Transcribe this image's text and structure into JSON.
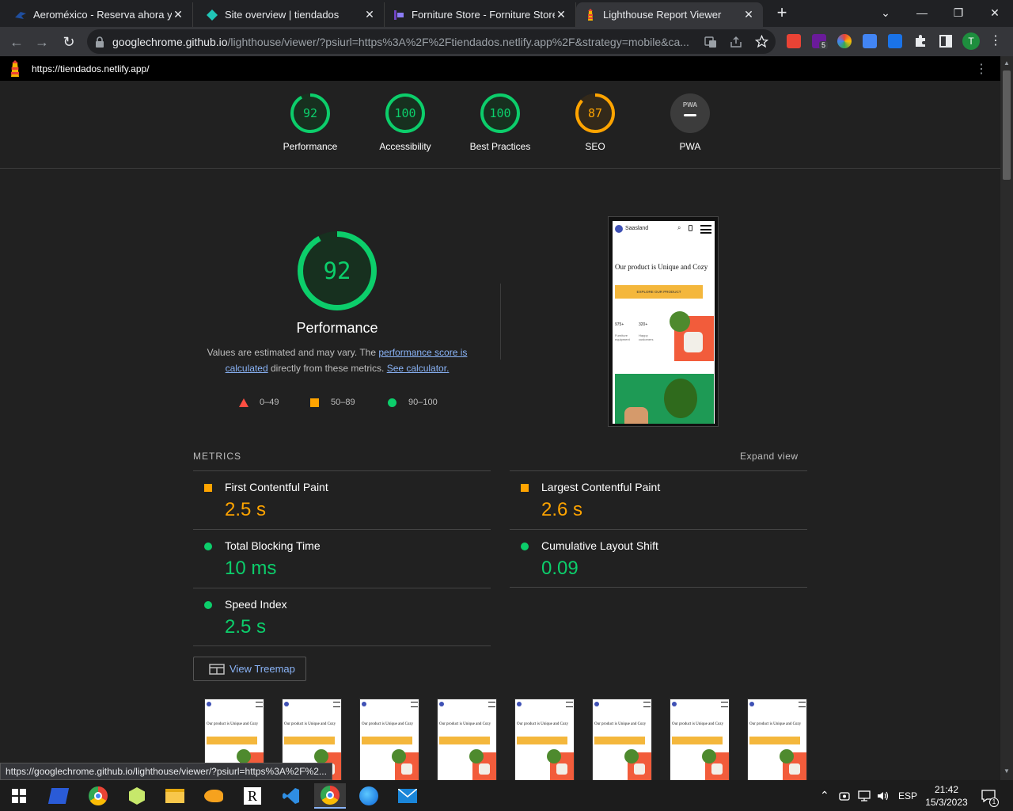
{
  "browser": {
    "tabs": [
      {
        "title": "Aeroméxico - Reserva ahora y vu",
        "close": "✕"
      },
      {
        "title": "Site overview | tiendados",
        "close": "✕"
      },
      {
        "title": "Forniture Store - Forniture Store",
        "close": "✕"
      },
      {
        "title": "Lighthouse Report Viewer",
        "close": "✕"
      }
    ],
    "new_tab": "+",
    "url_host": "googlechrome.github.io",
    "url_path": "/lighthouse/viewer/?psiurl=https%3A%2F%2Ftiendados.netlify.app%2F&strategy=mobile&ca...",
    "ext_badge": "5",
    "profile_initial": "T"
  },
  "report": {
    "topbar_url": "https://tiendados.netlify.app/",
    "scores": [
      {
        "value": "92",
        "label": "Performance",
        "color": "#0cce6b",
        "fraction": 0.92
      },
      {
        "value": "100",
        "label": "Accessibility",
        "color": "#0cce6b",
        "fraction": 1.0
      },
      {
        "value": "100",
        "label": "Best Practices",
        "color": "#0cce6b",
        "fraction": 1.0
      },
      {
        "value": "87",
        "label": "SEO",
        "color": "#ffa400",
        "fraction": 0.87
      },
      {
        "value": "",
        "label": "PWA",
        "color": "#9e9e9e",
        "fraction": 0
      }
    ],
    "pwa_badge": "PWA",
    "perf": {
      "score": "92",
      "fraction": 0.92,
      "title": "Performance",
      "desc_1": "Values are estimated and may vary. The ",
      "link_1": "performance score is calculated",
      "desc_2": " directly from these metrics. ",
      "link_2": "See calculator."
    },
    "legend": [
      {
        "range": "0–49",
        "shape": "triangle",
        "color": "#ff4e42"
      },
      {
        "range": "50–89",
        "shape": "square",
        "color": "#ffa400"
      },
      {
        "range": "90–100",
        "shape": "circle",
        "color": "#0cce6b"
      }
    ],
    "screenshot": {
      "brand": "Saasland",
      "headline": "Our product is Unique and Cozy",
      "cta": "EXPLORE OUR PRODUCT",
      "stat1": "975+",
      "stat1_label": "Furniture equipment",
      "stat2": "320+",
      "stat2_label": "Happy customers"
    },
    "metrics_heading": "METRICS",
    "expand_view": "Expand view",
    "metrics": [
      {
        "name": "First Contentful Paint",
        "value": "2.5 s",
        "rating": "average",
        "color": "#ffa400"
      },
      {
        "name": "Largest Contentful Paint",
        "value": "2.6 s",
        "rating": "average",
        "color": "#ffa400"
      },
      {
        "name": "Total Blocking Time",
        "value": "10 ms",
        "rating": "pass",
        "color": "#0cce6b"
      },
      {
        "name": "Cumulative Layout Shift",
        "value": "0.09",
        "rating": "pass",
        "color": "#0cce6b"
      },
      {
        "name": "Speed Index",
        "value": "2.5 s",
        "rating": "pass",
        "color": "#0cce6b"
      }
    ],
    "treemap_label": "View Treemap",
    "filmstrip_count": 8,
    "filmstrip_headline": "Our product is Unique and Cozy"
  },
  "status_url": "https://googlechrome.github.io/lighthouse/viewer/?psiurl=https%3A%2F%2...",
  "taskbar": {
    "lang": "ESP",
    "time": "21:42",
    "date": "15/3/2023",
    "notif_count": "1"
  }
}
